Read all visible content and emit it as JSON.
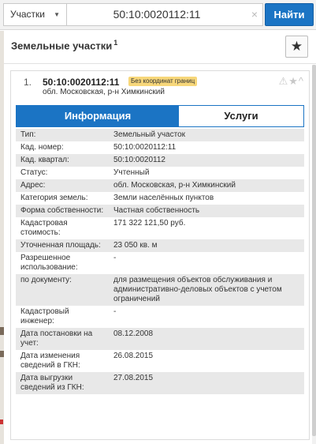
{
  "search": {
    "type_label": "Участки",
    "query": "50:10:0020112:11",
    "clear_icon": "×",
    "find_label": "Найти"
  },
  "section": {
    "title": "Земельные участки",
    "count": "1",
    "fav_icon": "★"
  },
  "card": {
    "index": "1.",
    "number": "50:10:0020112:11",
    "badge": "Без координат границ",
    "address": "обл. Московская, р-н Химкинский",
    "tools": "⚠★^"
  },
  "tabs": {
    "info": "Информация",
    "services": "Услуги"
  },
  "rows": [
    {
      "label": "Тип:",
      "value": "Земельный участок"
    },
    {
      "label": "Кад. номер:",
      "value": "50:10:0020112:11"
    },
    {
      "label": "Кад. квартал:",
      "value": "50:10:0020112"
    },
    {
      "label": "Статус:",
      "value": "Учтенный"
    },
    {
      "label": "Адрес:",
      "value": "обл. Московская, р-н Химкинский"
    },
    {
      "label": "Категория земель:",
      "value": "Земли населённых пунктов"
    },
    {
      "label": "Форма собственности:",
      "value": "Частная собственность"
    },
    {
      "label": "Кадастровая стоимость:",
      "value": "171 322 121,50 руб."
    },
    {
      "label": "Уточненная площадь:",
      "value": "23 050 кв. м"
    },
    {
      "label": "Разрешенное использование:",
      "value": "-"
    },
    {
      "label": "по документу:",
      "value": "для размещения объектов обслуживания и административно-деловых объектов с учетом ограничений"
    },
    {
      "label": "Кадастровый инженер:",
      "value": "-"
    },
    {
      "label": "Дата постановки на учет:",
      "value": "08.12.2008"
    },
    {
      "label": "Дата изменения сведений в ГКН:",
      "value": "26.08.2015"
    },
    {
      "label": "Дата выгрузки сведений из ГКН:",
      "value": "27.08.2015"
    }
  ],
  "colors": {
    "accent": "#1b74c4",
    "badge": "#f7d77a",
    "link": "#1b67b3"
  }
}
